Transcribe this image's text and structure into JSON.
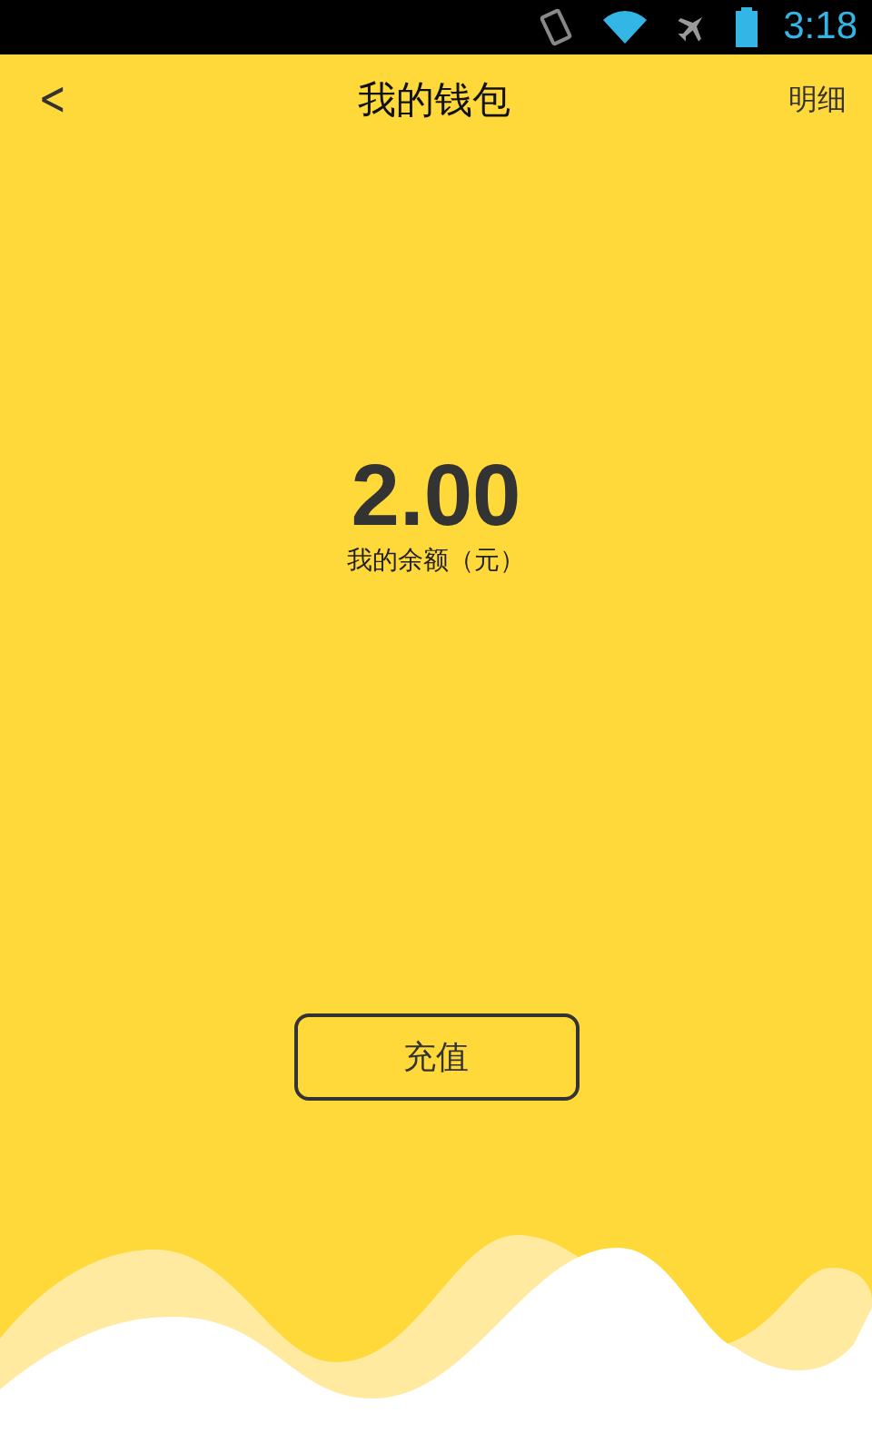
{
  "status_bar": {
    "time": "3:18"
  },
  "header": {
    "back": "<",
    "title": "我的钱包",
    "action": "明细"
  },
  "balance": {
    "amount": "2.00",
    "label": "我的余额（元）"
  },
  "recharge_button": "充值"
}
